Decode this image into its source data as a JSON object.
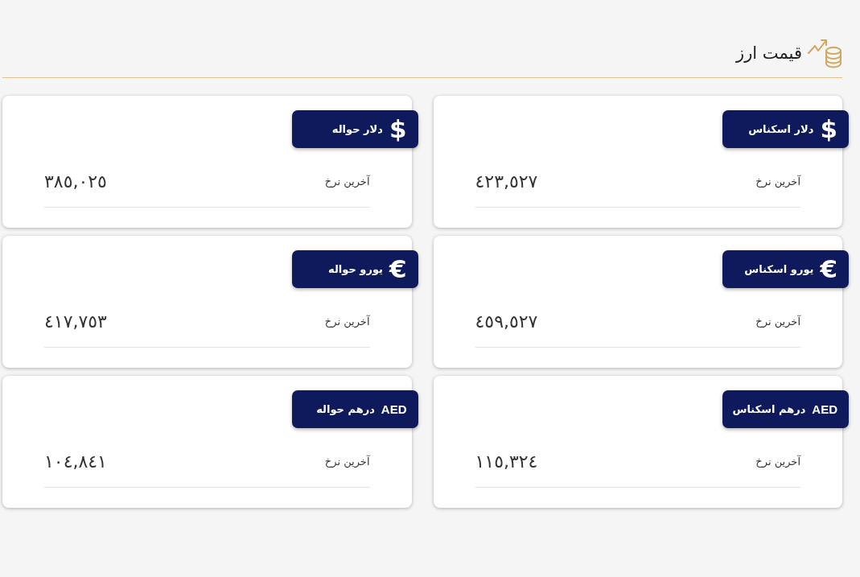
{
  "header": {
    "title": "قیمت ارز"
  },
  "rate_cards": [
    {
      "kind": "glyph",
      "symbol": "$",
      "name": "دلار اسکناس",
      "label": "آخرین نرخ",
      "value": "٤٢٣,٥٢٧"
    },
    {
      "kind": "glyph",
      "symbol": "$",
      "name": "دلار حواله",
      "label": "آخرین نرخ",
      "value": "٣٨٥,٠٢٥"
    },
    {
      "kind": "glyph",
      "symbol": "€",
      "name": "یورو اسکناس",
      "label": "آخرین نرخ",
      "value": "٤٥٩,٥٢٧"
    },
    {
      "kind": "glyph",
      "symbol": "€",
      "name": "یورو حواله",
      "label": "آخرین نرخ",
      "value": "٤١٧,٧٥٣"
    },
    {
      "kind": "code",
      "symbol": "AED",
      "name": "درهم اسکناس",
      "label": "آخرین نرخ",
      "value": "١١٥,٣٢٤"
    },
    {
      "kind": "code",
      "symbol": "AED",
      "name": "درهم حواله",
      "label": "آخرین نرخ",
      "value": "١٠٤,٨٤١"
    }
  ]
}
